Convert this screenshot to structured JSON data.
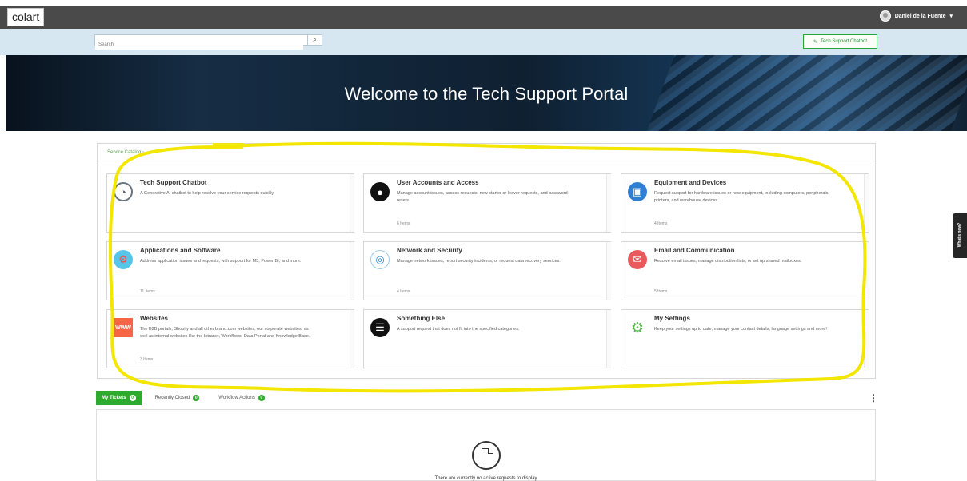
{
  "header": {
    "logo": "colart",
    "user_name": "Daniel de la Fuente",
    "user_caret": "▾"
  },
  "search": {
    "placeholder": "Search",
    "button_icon": "⌕"
  },
  "chatbot_button": {
    "label": "Tech Support Chatbot",
    "icon": "✎"
  },
  "hero": {
    "title": "Welcome to the Tech Support Portal"
  },
  "catalog": {
    "breadcrumb": "Service Catalog  ›",
    "cards": [
      {
        "title": "Tech Support Chatbot",
        "description": "A Generative AI chatbot to help resolve your service requests quickly",
        "count": "",
        "icon": "robot-icon"
      },
      {
        "title": "User Accounts and Access",
        "description": "Manage account issues, access requests, new starter or leaver requests, and password resets.",
        "count": "6 Items",
        "icon": "user-icon"
      },
      {
        "title": "Equipment and Devices",
        "description": "Request support for hardware issues or new equipment, including computers, peripherals, printers, and warehouse devices.",
        "count": "4 Items",
        "icon": "monitor-icon"
      },
      {
        "title": "Applications and Software",
        "description": "Address application issues and requests, with support for M3, Power BI, and more.",
        "count": "11 Items",
        "icon": "software-icon"
      },
      {
        "title": "Network and Security",
        "description": "Manage network issues, report security incidents, or request data recovery services.",
        "count": "4 Items",
        "icon": "globe-icon"
      },
      {
        "title": "Email and Communication",
        "description": "Resolve email issues, manage distribution lists, or set up shared mailboxes.",
        "count": "5 Items",
        "icon": "mail-icon"
      },
      {
        "title": "Websites",
        "description": "The B2B portals, Shopify and all other brand.com websites, our corporate websites, as well as internal websites like the Intranet, Workflows, Data Portal and Knowledge Base.",
        "count": "3 Items",
        "icon": "website-icon"
      },
      {
        "title": "Something Else",
        "description": "A support request that does not fit into the specified categories.",
        "count": "",
        "icon": "list-icon"
      },
      {
        "title": "My Settings",
        "description": "Keep your settings up to date, manage your contact details, language settings and more!",
        "count": "",
        "icon": "gear-icon"
      }
    ]
  },
  "tabs": [
    {
      "label": "My Tickets",
      "count": "0"
    },
    {
      "label": "Recently Closed",
      "count": "0"
    },
    {
      "label": "Workflow Actions",
      "count": "0"
    }
  ],
  "tickets": {
    "empty_message": "There are currently no active requests to display"
  },
  "side_tab": {
    "label": "What's new?"
  },
  "colors": {
    "accent_green": "#2eaa2d",
    "hero_blue": "#143452",
    "annotation_yellow": "#f3e600"
  }
}
